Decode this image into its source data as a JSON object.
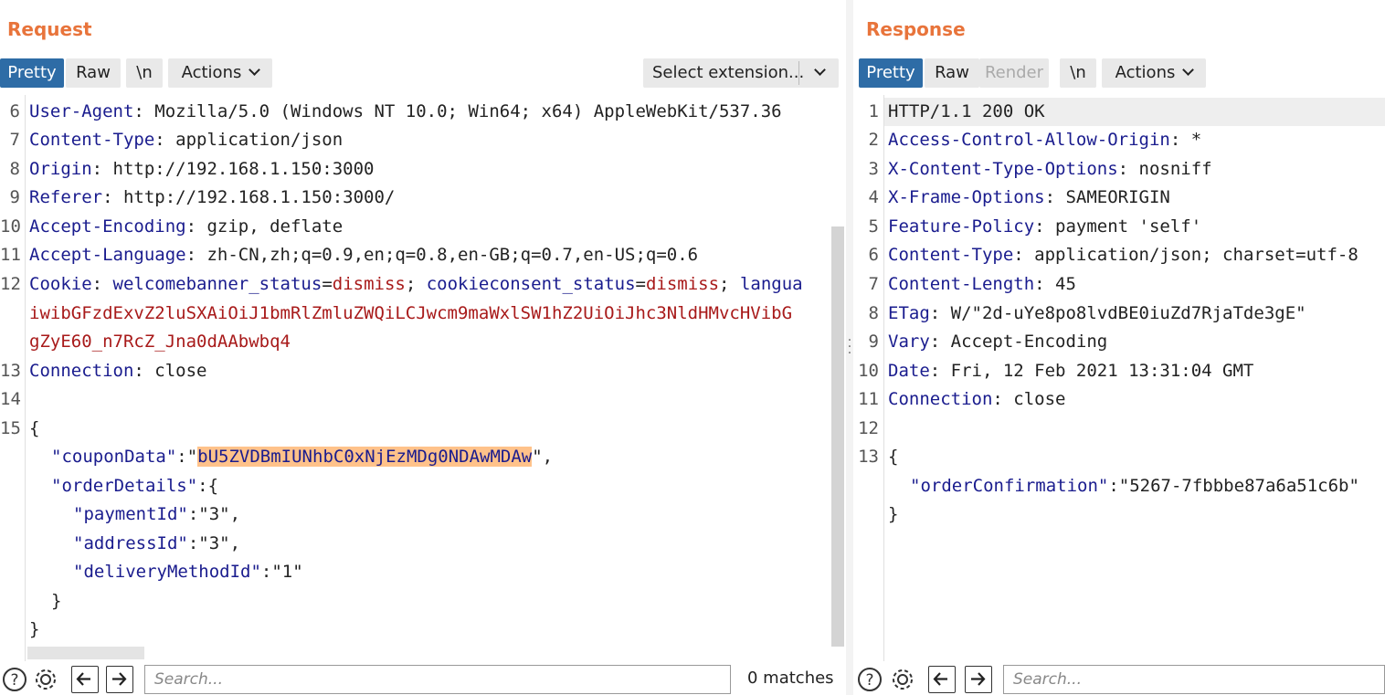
{
  "request": {
    "title": "Request",
    "tabs": [
      "Pretty",
      "Raw",
      "\\n"
    ],
    "actions_label": "Actions",
    "extension_select": "Select extension...",
    "lines": [
      {
        "n": "6",
        "key": "User-Agent",
        "val": ": Mozilla/5.0 (Windows NT 10.0; Win64; x64) AppleWebKit/537.36"
      },
      {
        "n": "7",
        "key": "Content-Type",
        "val": ": application/json"
      },
      {
        "n": "8",
        "key": "Origin",
        "val": ": http://192.168.1.150:3000"
      },
      {
        "n": "9",
        "key": "Referer",
        "val": ": http://192.168.1.150:3000/"
      },
      {
        "n": "10",
        "key": "Accept-Encoding",
        "val": ": gzip, deflate"
      },
      {
        "n": "11",
        "key": "Accept-Language",
        "val": ": zh-CN,zh;q=0.9,en;q=0.8,en-GB;q=0.7,en-US;q=0.6"
      }
    ],
    "cookie": {
      "n": "12",
      "key": "Cookie",
      "c1_name": "welcomebanner_status",
      "c1_val": "dismiss",
      "c2_name": "cookieconsent_status",
      "c2_val": "dismiss",
      "c3_name": "langua",
      "wrap1": "iwibGFzdExvZ2luSXAiOiJ1bmRlZmluZWQiLCJwcm9maWxlSW1hZ2UiOiJhc3NldHMvcHVibG",
      "wrap2": "gZyE60_n7RcZ_Jna0dAAbwbq4"
    },
    "after": [
      {
        "n": "13",
        "key": "Connection",
        "val": ": close"
      },
      {
        "n": "14",
        "key": "",
        "val": ""
      }
    ],
    "body": {
      "n": "15",
      "open": "{",
      "coupon_key": "\"couponData\"",
      "coupon_val": "bU5ZVDBmIUNhbC0xNjEzMDg0NDAwMDAw",
      "order_key": "\"orderDetails\"",
      "payment_key": "\"paymentId\"",
      "payment_val": "\"3\"",
      "address_key": "\"addressId\"",
      "address_val": "\"3\"",
      "delivery_key": "\"deliveryMethodId\"",
      "delivery_val": "\"1\"",
      "close_inner": "}",
      "close": "}"
    },
    "search_placeholder": "Search...",
    "matches": "0 matches"
  },
  "response": {
    "title": "Response",
    "tabs": [
      "Pretty",
      "Raw",
      "Render",
      "\\n"
    ],
    "actions_label": "Actions",
    "status_line": "HTTP/1.1 200 OK",
    "lines": [
      {
        "n": "2",
        "key": "Access-Control-Allow-Origin",
        "val": ": *"
      },
      {
        "n": "3",
        "key": "X-Content-Type-Options",
        "val": ": nosniff"
      },
      {
        "n": "4",
        "key": "X-Frame-Options",
        "val": ": SAMEORIGIN"
      },
      {
        "n": "5",
        "key": "Feature-Policy",
        "val": ": payment 'self'"
      },
      {
        "n": "6",
        "key": "Content-Type",
        "val": ": application/json; charset=utf-8"
      },
      {
        "n": "7",
        "key": "Content-Length",
        "val": ": 45"
      },
      {
        "n": "8",
        "key": "ETag",
        "val": ": W/\"2d-uYe8po8lvdBE0iuZd7RjaTde3gE\""
      },
      {
        "n": "9",
        "key": "Vary",
        "val": ": Accept-Encoding"
      },
      {
        "n": "10",
        "key": "Date",
        "val": ": Fri, 12 Feb 2021 13:31:04 GMT"
      },
      {
        "n": "11",
        "key": "Connection",
        "val": ": close"
      },
      {
        "n": "12",
        "key": "",
        "val": ""
      }
    ],
    "body": {
      "n": "13",
      "open": "{",
      "key": "\"orderConfirmation\"",
      "val": "\"5267-7fbbbe87a6a51c6b\"",
      "close": "}"
    },
    "search_placeholder": "Search..."
  },
  "colors": {
    "accent": "#e8743b",
    "active_tab": "#2e6ca6",
    "header_key": "#1a1c8e",
    "cookie_value": "#a81a1a",
    "highlight": "#ffc28a"
  }
}
